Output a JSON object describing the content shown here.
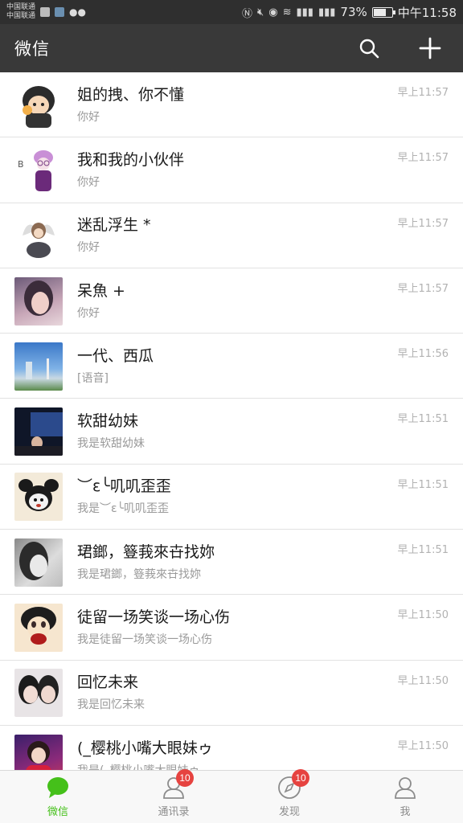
{
  "status_bar": {
    "carrier_1": "中国联通",
    "carrier_2": "中国联通",
    "battery_percent": "73%",
    "battery_level": 0.73,
    "time": "中午11:58"
  },
  "header": {
    "title": "微信",
    "search_icon": "search-icon",
    "add_icon": "plus-icon"
  },
  "chats": [
    {
      "name": "姐的拽、你不懂",
      "preview": "你好",
      "time": "早上11:57"
    },
    {
      "name": "我和我的小伙伴",
      "preview": "你好",
      "time": "早上11:57"
    },
    {
      "name": "迷乱浮生 *",
      "preview": "你好",
      "time": "早上11:57"
    },
    {
      "name": " 呆魚  +",
      "preview": "你好",
      "time": "早上11:57"
    },
    {
      "name": "一代、西瓜",
      "preview": "[语音]",
      "time": "早上11:56"
    },
    {
      "name": "软甜幼妹",
      "preview": "我是软甜幼妹",
      "time": "早上11:51"
    },
    {
      "name": "︶ε╰叽叽歪歪",
      "preview": "我是︶ε╰叽叽歪歪",
      "time": "早上11:51"
    },
    {
      "name": "珺鎯，簦莪來卋找妳",
      "preview": "我是珺鎯，簦莪來卋找妳",
      "time": "早上11:51"
    },
    {
      "name": "徒留一场笑谈一场心伤",
      "preview": "我是徒留一场笑谈一场心伤",
      "time": "早上11:50"
    },
    {
      "name": "回忆未来",
      "preview": "我是回忆未来",
      "time": "早上11:50"
    },
    {
      "name": "(_樱桃小嘴大眼妹ゥ",
      "preview": "我是(_樱桃小嘴大眼妹ゥ",
      "time": "早上11:50"
    }
  ],
  "tabs": [
    {
      "label": "微信",
      "icon": "chat-bubble-icon",
      "badge": ""
    },
    {
      "label": "通讯录",
      "icon": "contacts-icon",
      "badge": "10"
    },
    {
      "label": "发现",
      "icon": "compass-icon",
      "badge": "10"
    },
    {
      "label": "我",
      "icon": "person-icon",
      "badge": ""
    }
  ],
  "colors": {
    "header_bg": "#393939",
    "accent_green": "#45c01a",
    "badge_red": "#e64340"
  }
}
